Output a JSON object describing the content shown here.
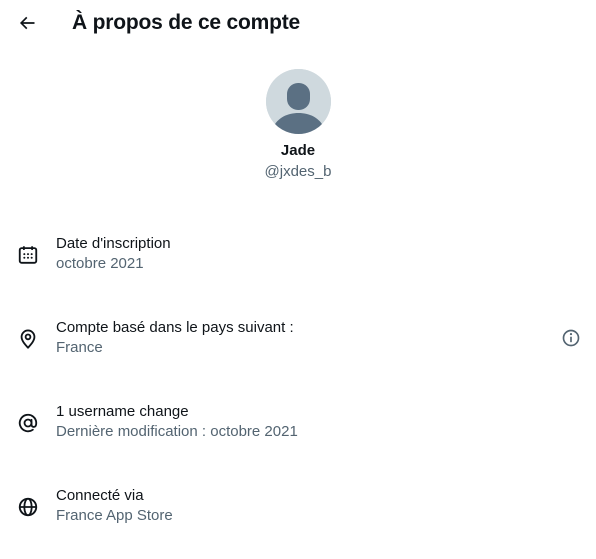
{
  "header": {
    "title": "À propos de ce compte",
    "back_icon": "arrow-left-icon"
  },
  "profile": {
    "display_name": "Jade",
    "handle": "@jxdes_b",
    "avatar_icon": "default-avatar-icon"
  },
  "rows": [
    {
      "icon": "calendar-icon",
      "label": "Date d'inscription",
      "value": "octobre 2021"
    },
    {
      "icon": "location-pin-icon",
      "label": "Compte basé dans le pays suivant :",
      "value": "France",
      "trailing_icon": "info-icon"
    },
    {
      "icon": "at-sign-icon",
      "label": "1 username change",
      "value": "Dernière modification : octobre 2021"
    },
    {
      "icon": "globe-icon",
      "label": "Connecté via",
      "value": "France App Store"
    }
  ],
  "colors": {
    "primary_text": "#0f1419",
    "secondary_text": "#536471",
    "avatar_bg": "#cfd9de",
    "avatar_fg": "#5b7083"
  }
}
